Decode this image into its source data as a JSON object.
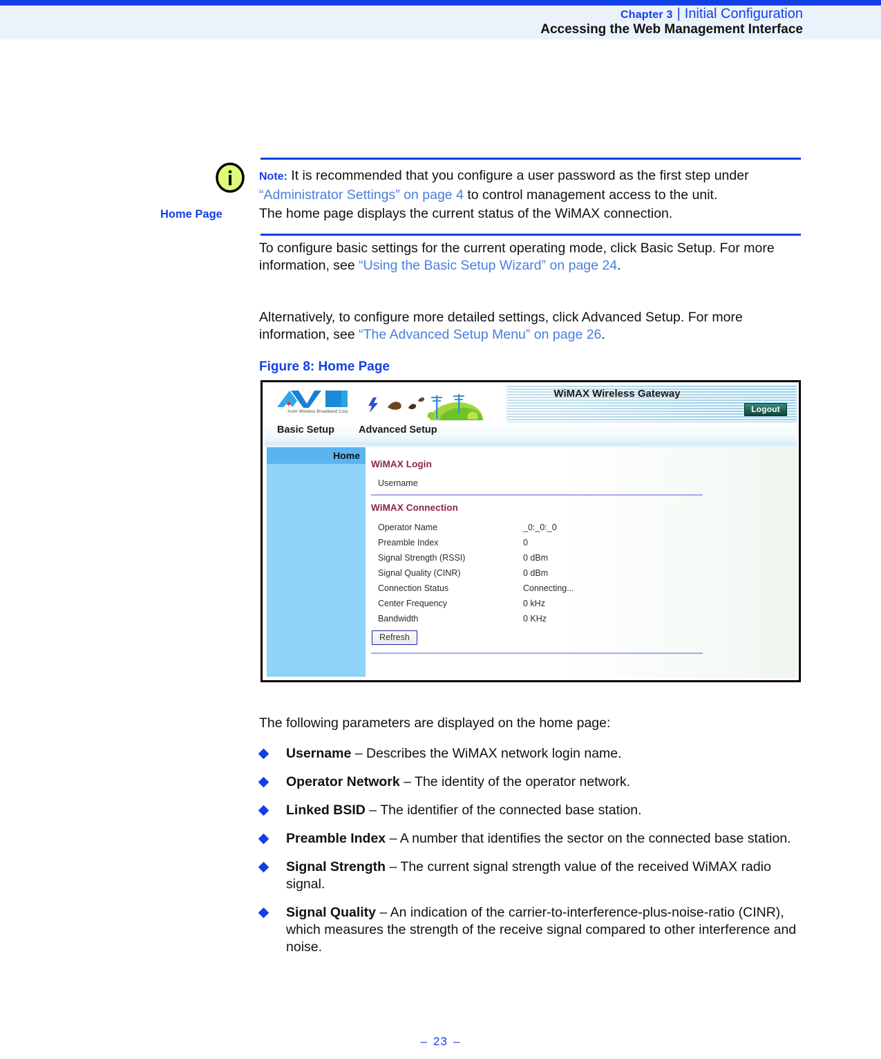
{
  "header": {
    "chapter_label": "Chapter 3",
    "chapter_title": "Initial Configuration",
    "separator": "|",
    "subtitle": "Accessing the Web Management Interface"
  },
  "note": {
    "icon": "info-icon",
    "label": "Note:",
    "text_before": " It is recommended that you configure a user password as the first step under ",
    "link": "“Administrator Settings” on page 4",
    "text_after": " to control management access to the unit."
  },
  "section": {
    "heading": "Home Page",
    "paragraph1": "The home page displays the current status of the WiMAX connection.",
    "paragraph2_before": "To configure basic settings for the current operating mode, click Basic Setup. For more information, see ",
    "paragraph2_link": "“Using the Basic Setup Wizard” on page 24",
    "paragraph2_after": ".",
    "paragraph3_before": "Alternatively, to configure more detailed settings, click Advanced Setup. For more information, see ",
    "paragraph3_link": "“The Advanced Setup Menu” on page 26",
    "paragraph3_after": "."
  },
  "figure": {
    "caption": "Figure 8:  Home Page",
    "ui": {
      "logo_text": "AWB",
      "logo_tagline": "Acter Wireless Broadband Corp",
      "title": "WiMAX Wireless Gateway",
      "logout_label": "Logout",
      "nav": {
        "basic": "Basic Setup",
        "advanced": "Advanced Setup"
      },
      "sidebar": {
        "items": [
          {
            "label": "Home",
            "selected": true
          }
        ]
      },
      "login_section": {
        "title": "WiMAX Login",
        "fields": [
          {
            "label": "Username",
            "value": ""
          }
        ]
      },
      "connection_section": {
        "title": "WiMAX Connection",
        "fields": [
          {
            "label": "Operator Name",
            "value": "_0:_0:_0"
          },
          {
            "label": "Preamble Index",
            "value": "0"
          },
          {
            "label": "Signal Strength (RSSI)",
            "value": "0 dBm"
          },
          {
            "label": "Signal Quality (CINR)",
            "value": "0 dBm"
          },
          {
            "label": "Connection Status",
            "value": "Connecting..."
          },
          {
            "label": "Center Frequency",
            "value": "0 kHz"
          },
          {
            "label": "Bandwidth",
            "value": "0 KHz"
          }
        ]
      },
      "refresh_label": "Refresh"
    }
  },
  "params": {
    "lead": "The following parameters are displayed on the home page:",
    "items": [
      {
        "term": "Username",
        "desc": " – Describes the WiMAX network login name."
      },
      {
        "term": "Operator Network",
        "desc": " – The identity of the operator network."
      },
      {
        "term": "Linked BSID",
        "desc": " – The identifier of the connected base station."
      },
      {
        "term": "Preamble Index",
        "desc": " – A number that identifies the sector on the connected base station."
      },
      {
        "term": "Signal Strength",
        "desc": " – The current signal strength value of the received WiMAX radio signal."
      },
      {
        "term": "Signal Quality",
        "desc": " – An indication of the carrier-to-interference-plus-noise-ratio (CINR), which measures the strength of the receive signal compared to other interference and noise."
      }
    ]
  },
  "footer": {
    "dash_left": "–",
    "page_number": "23",
    "dash_right": "–"
  },
  "colors": {
    "accent_blue": "#1340e6",
    "link_blue": "#4a7ddb",
    "header_band": "#ebf2fb",
    "ui_heading_maroon": "#8c2343",
    "sidebar_blue": "#8fd3f8",
    "sidebar_selected": "#5bb4ef",
    "note_icon_fill": "#ddfa79"
  }
}
